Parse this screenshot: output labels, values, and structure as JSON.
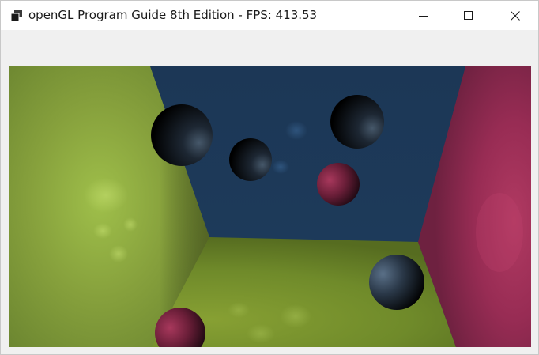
{
  "window": {
    "title": "openGL Program Guide 8th Edition - FPS: 413.53",
    "icons": {
      "app": "app-icon",
      "minimize": "minimize-icon",
      "maximize": "maximize-icon",
      "close": "close-icon"
    }
  },
  "scene": {
    "colors": {
      "left_wall": "#8fa83e",
      "back_wall": "#1e3b5a",
      "right_wall": "#9a2a52",
      "floor": "#7a8f2e",
      "sphere_dark": "#2a3a4c",
      "sphere_red": "#8a2a48"
    }
  }
}
